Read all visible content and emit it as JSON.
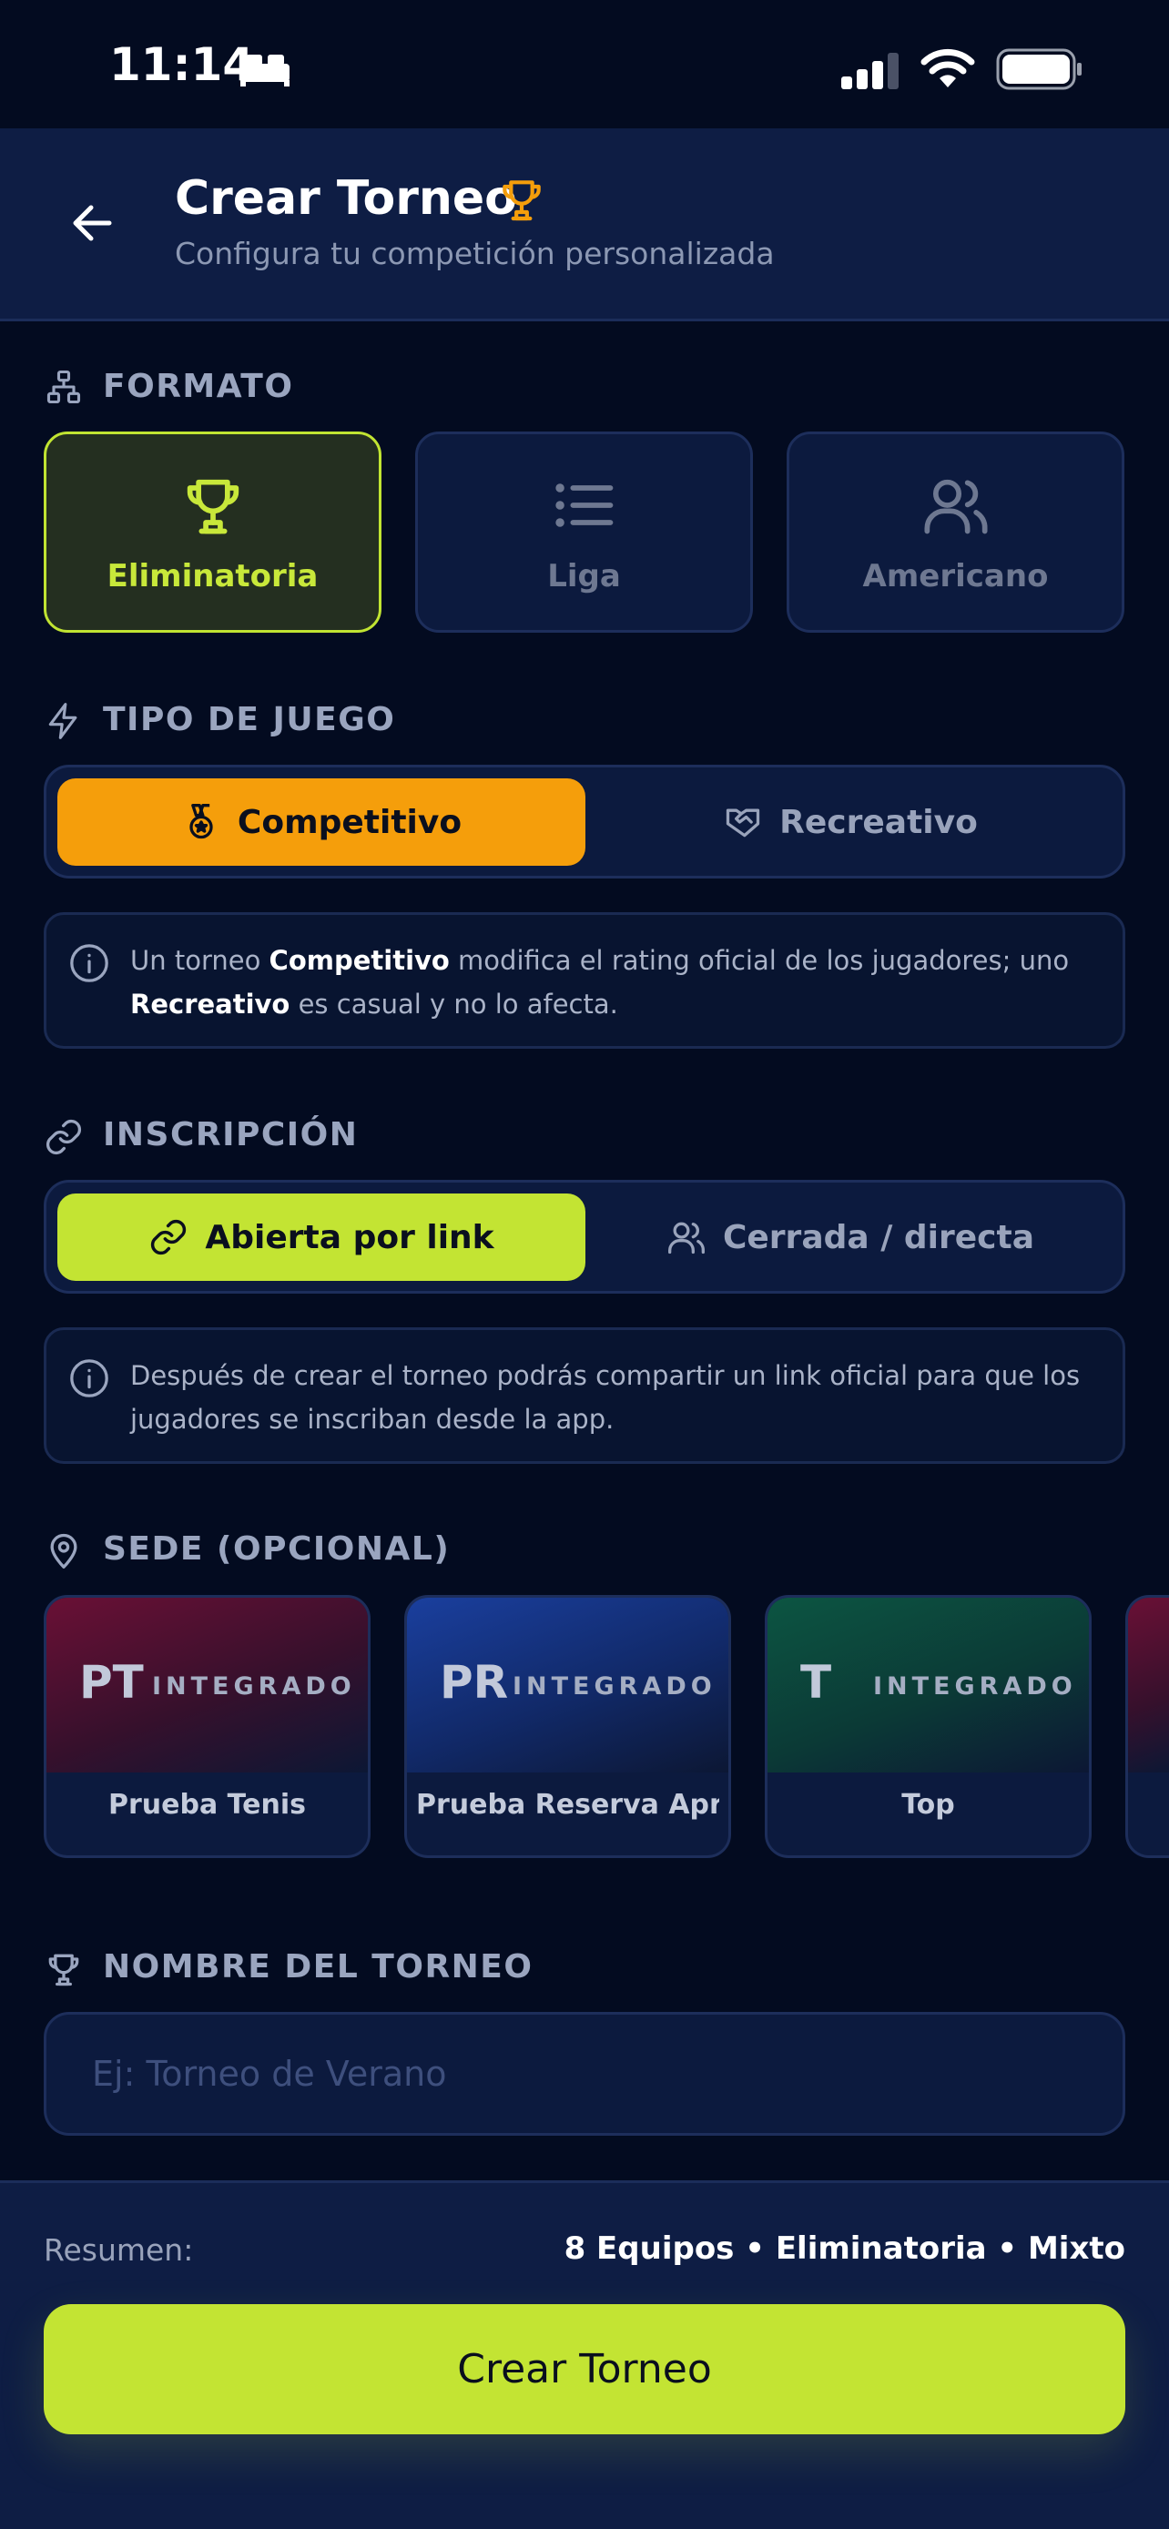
{
  "status_bar": {
    "time": "11:14"
  },
  "header": {
    "title": "Crear Torneo",
    "subtitle": "Configura tu competición personalizada"
  },
  "format": {
    "label": "FORMATO",
    "options": [
      {
        "label": "Eliminatoria",
        "icon": "trophy-icon",
        "selected": true
      },
      {
        "label": "Liga",
        "icon": "list-icon",
        "selected": false
      },
      {
        "label": "Americano",
        "icon": "users-icon",
        "selected": false
      }
    ]
  },
  "game_type": {
    "label": "TIPO DE JUEGO",
    "options": [
      {
        "label": "Competitivo",
        "icon": "medal-icon",
        "selected": true
      },
      {
        "label": "Recreativo",
        "icon": "handshake-icon",
        "selected": false
      }
    ],
    "info": {
      "pre": "Un torneo ",
      "bold1": "Competitivo",
      "mid": " modifica el rating oficial de los jugadores; uno ",
      "bold2": "Recreativo",
      "post": " es casual y no lo afecta."
    }
  },
  "registration": {
    "label": "INSCRIPCIÓN",
    "options": [
      {
        "label": "Abierta por link",
        "icon": "link-icon",
        "selected": true
      },
      {
        "label": "Cerrada / directa",
        "icon": "users-icon",
        "selected": false
      }
    ],
    "info": "Después de crear el torneo podrás compartir un link oficial para que los jugadores se inscriban desde la app."
  },
  "venue": {
    "label": "SEDE (OPCIONAL)",
    "cards": [
      {
        "initials": "PT",
        "tag": "INTEGRADO",
        "name": "Prueba Tenis",
        "color": "#6a1035"
      },
      {
        "initials": "PR",
        "tag": "INTEGRADO",
        "name": "Prueba Reserva Apr...",
        "color": "#1a3f9e"
      },
      {
        "initials": "T",
        "tag": "INTEGRADO",
        "name": "Top",
        "color": "#0c5542"
      }
    ]
  },
  "tournament_name": {
    "label": "NOMBRE DEL TORNEO",
    "placeholder": "Ej: Torneo de Verano",
    "value": ""
  },
  "footer": {
    "summary_label": "Resumen:",
    "summary_value": "8 Equipos • Eliminatoria • Mixto",
    "create_label": "Crear Torneo"
  },
  "colors": {
    "background": "#030b20",
    "header": "#0e1d44",
    "accent_lime": "#c3e433",
    "accent_orange": "#f59e0b"
  }
}
